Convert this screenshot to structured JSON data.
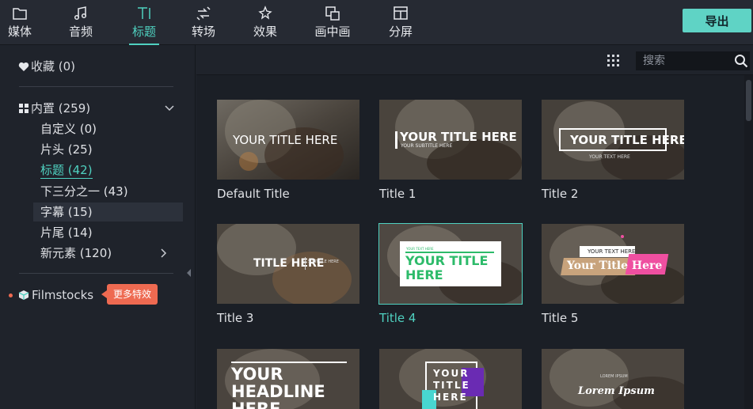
{
  "toolbar": {
    "tabs": [
      {
        "label": "媒体",
        "icon": "folder-icon"
      },
      {
        "label": "音频",
        "icon": "music-note-icon"
      },
      {
        "label": "标题",
        "icon": "title-text-icon"
      },
      {
        "label": "转场",
        "icon": "transition-icon"
      },
      {
        "label": "效果",
        "icon": "effects-icon"
      },
      {
        "label": "画中画",
        "icon": "pip-icon"
      },
      {
        "label": "分屏",
        "icon": "split-screen-icon"
      }
    ],
    "active_tab": "标题",
    "export_label": "导出"
  },
  "sidebar": {
    "favorites": "收藏 (0)",
    "builtin": "内置 (259)",
    "items": [
      {
        "label": "自定义 (0)"
      },
      {
        "label": "片头 (25)"
      },
      {
        "label": "标题 (42)"
      },
      {
        "label": "下三分之一 (43)"
      },
      {
        "label": "字幕 (15)"
      },
      {
        "label": "片尾 (14)"
      },
      {
        "label": "新元素 (120)"
      }
    ],
    "active_item": "标题 (42)",
    "highlighted_item": "字幕 (15)",
    "filmstocks": "Filmstocks",
    "filmstocks_badge": "更多特效"
  },
  "search": {
    "placeholder": "搜索"
  },
  "titles": [
    {
      "label": "Default Title",
      "text": [
        "YOUR TITLE HERE"
      ]
    },
    {
      "label": "Title 1",
      "text": [
        "YOUR TITLE HERE",
        "YOUR SUBTITLE HERE"
      ]
    },
    {
      "label": "Title 2",
      "text": [
        "YOUR TITLE HERE",
        "YOUR TEXT HERE"
      ]
    },
    {
      "label": "Title 3",
      "text": [
        "TITLE HERE",
        "SUBTITLE HERE"
      ]
    },
    {
      "label": "Title 4",
      "text": [
        "YOUR TITLE",
        "HERE",
        "YOUR TEXT HERE"
      ]
    },
    {
      "label": "Title 5",
      "text": [
        "YOUR TEXT HERE",
        "Your Title Here"
      ]
    },
    {
      "label": "",
      "text": [
        "YOUR",
        "HEADLINE",
        "HERE"
      ]
    },
    {
      "label": "",
      "text": [
        "YOUR",
        "TITLE",
        "HERE"
      ]
    },
    {
      "label": "",
      "text": [
        "Lorem Ipsum",
        "LOREM IPSUM"
      ]
    }
  ],
  "selected_title": "Title 4",
  "colors": {
    "accent": "#4fd1c0",
    "export_button": "#5fd3c5",
    "badge": "#ee6a51",
    "panel": "#1f232b"
  }
}
